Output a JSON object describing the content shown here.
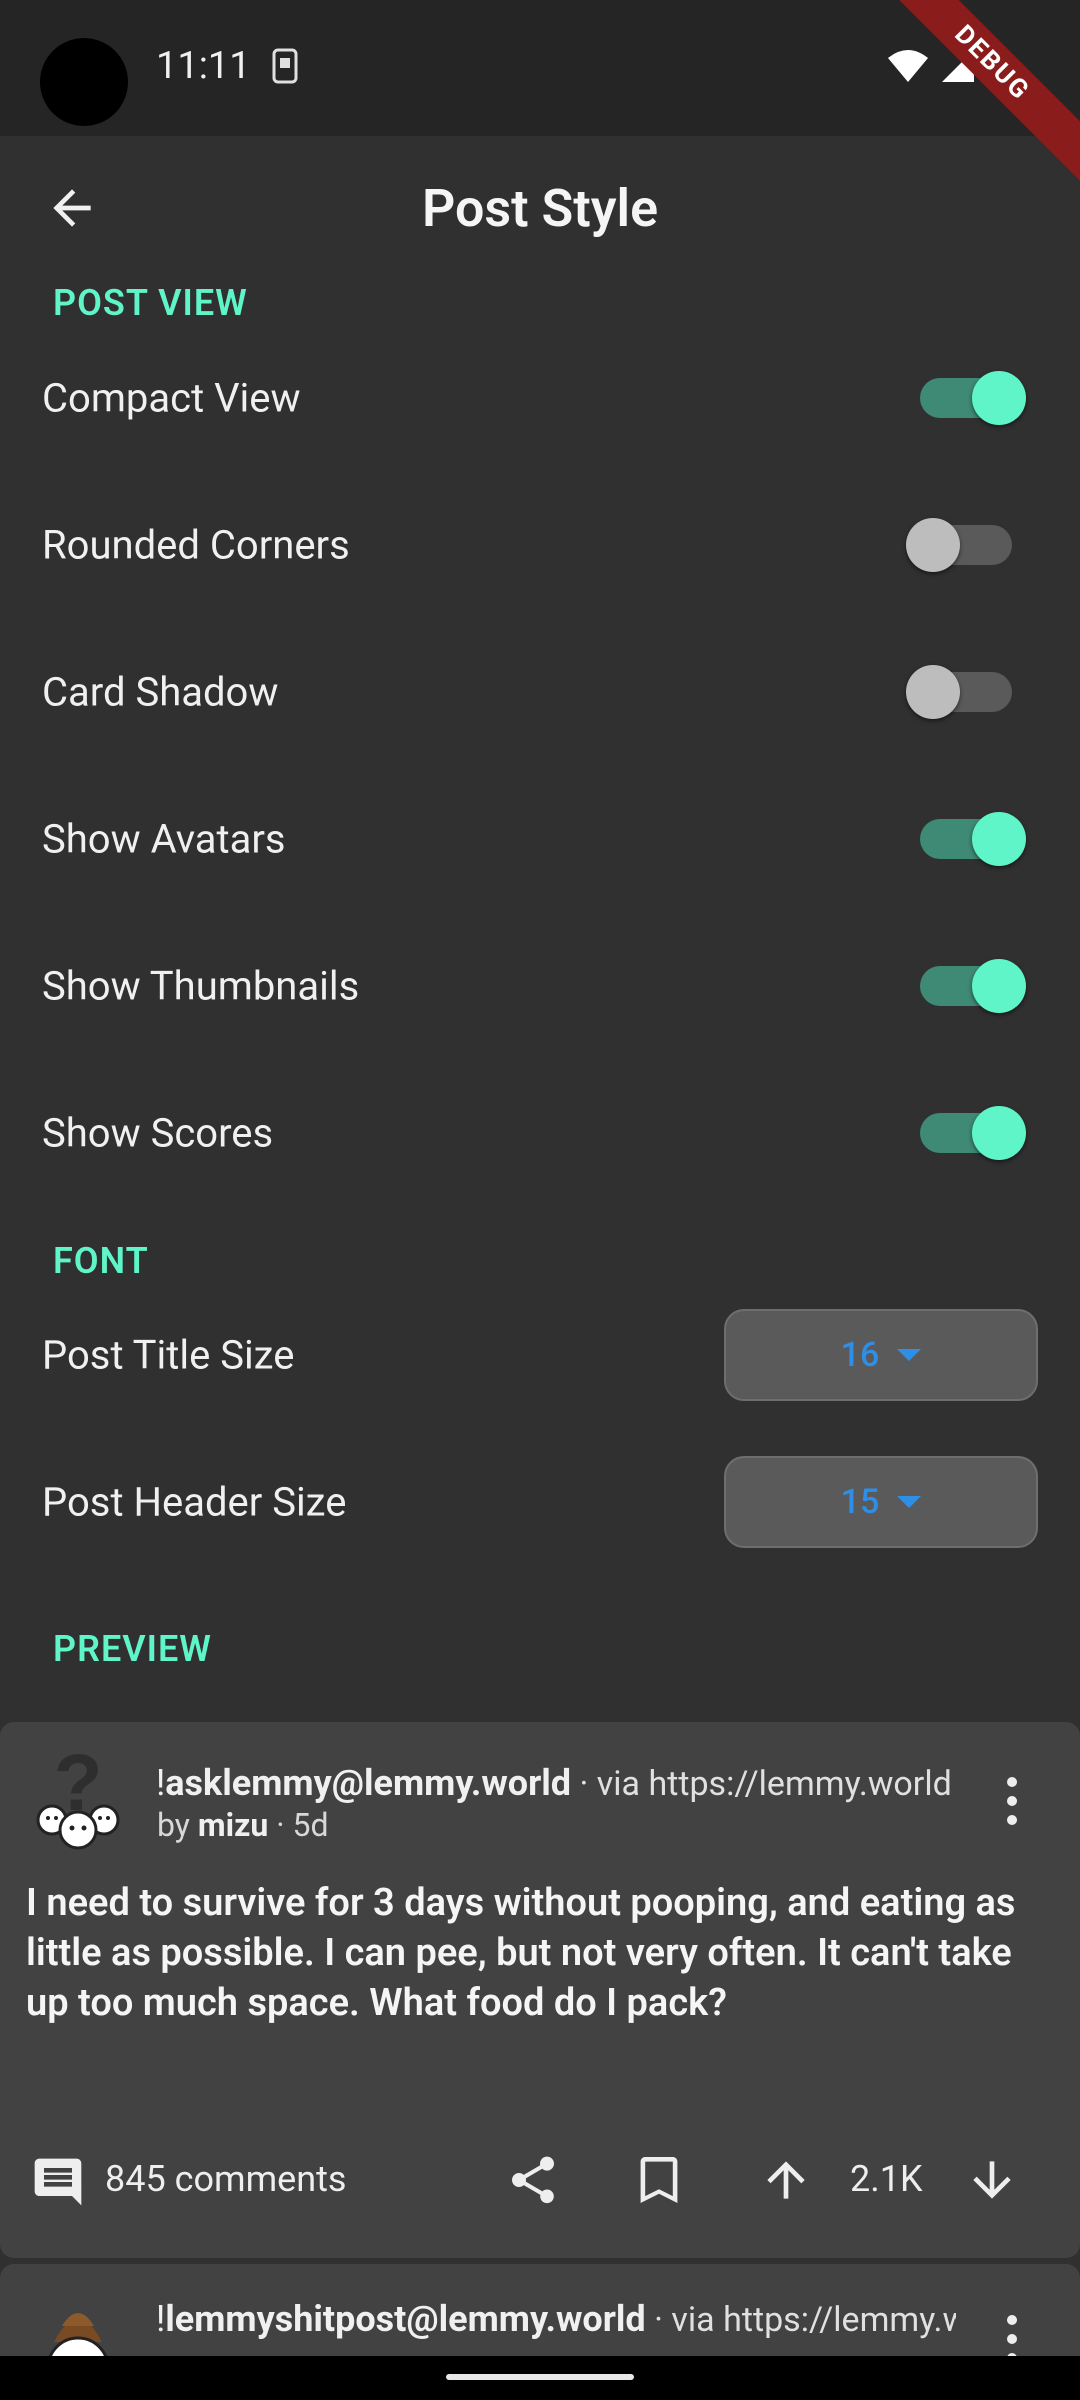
{
  "status_bar": {
    "time": "11:11",
    "debug_label": "DEBUG"
  },
  "app_bar": {
    "title": "Post Style"
  },
  "sections": {
    "post_view": "POST VIEW",
    "font": "FONT",
    "preview": "PREVIEW"
  },
  "toggles": [
    {
      "label": "Compact View",
      "on": true
    },
    {
      "label": "Rounded Corners",
      "on": false
    },
    {
      "label": "Card Shadow",
      "on": false
    },
    {
      "label": "Show Avatars",
      "on": true
    },
    {
      "label": "Show Thumbnails",
      "on": true
    },
    {
      "label": "Show Scores",
      "on": true
    }
  ],
  "font_settings": [
    {
      "label": "Post Title Size",
      "value": "16"
    },
    {
      "label": "Post Header Size",
      "value": "15"
    }
  ],
  "posts": [
    {
      "community_prefix": "!",
      "community": "asklemmy",
      "instance": "@lemmy.world",
      "via": " · via https://lemmy.world",
      "by_prefix": "by ",
      "author": "mizu",
      "age": " · 5d",
      "title": "I need to survive for 3 days without pooping, and eating as little as possible. I can pee, but not very often. It can't take up too much space. What food do I pack?",
      "comments": "845 comments",
      "score": "2.1K"
    },
    {
      "community_prefix": "!",
      "community": "lemmyshitpost",
      "instance": "@lemmy.world",
      "via": " · via https://lemmy.world"
    }
  ],
  "colors": {
    "accent": "#5ff5c8",
    "dropdown_text": "#2f8ee6",
    "background": "#303030",
    "card": "#424242"
  }
}
